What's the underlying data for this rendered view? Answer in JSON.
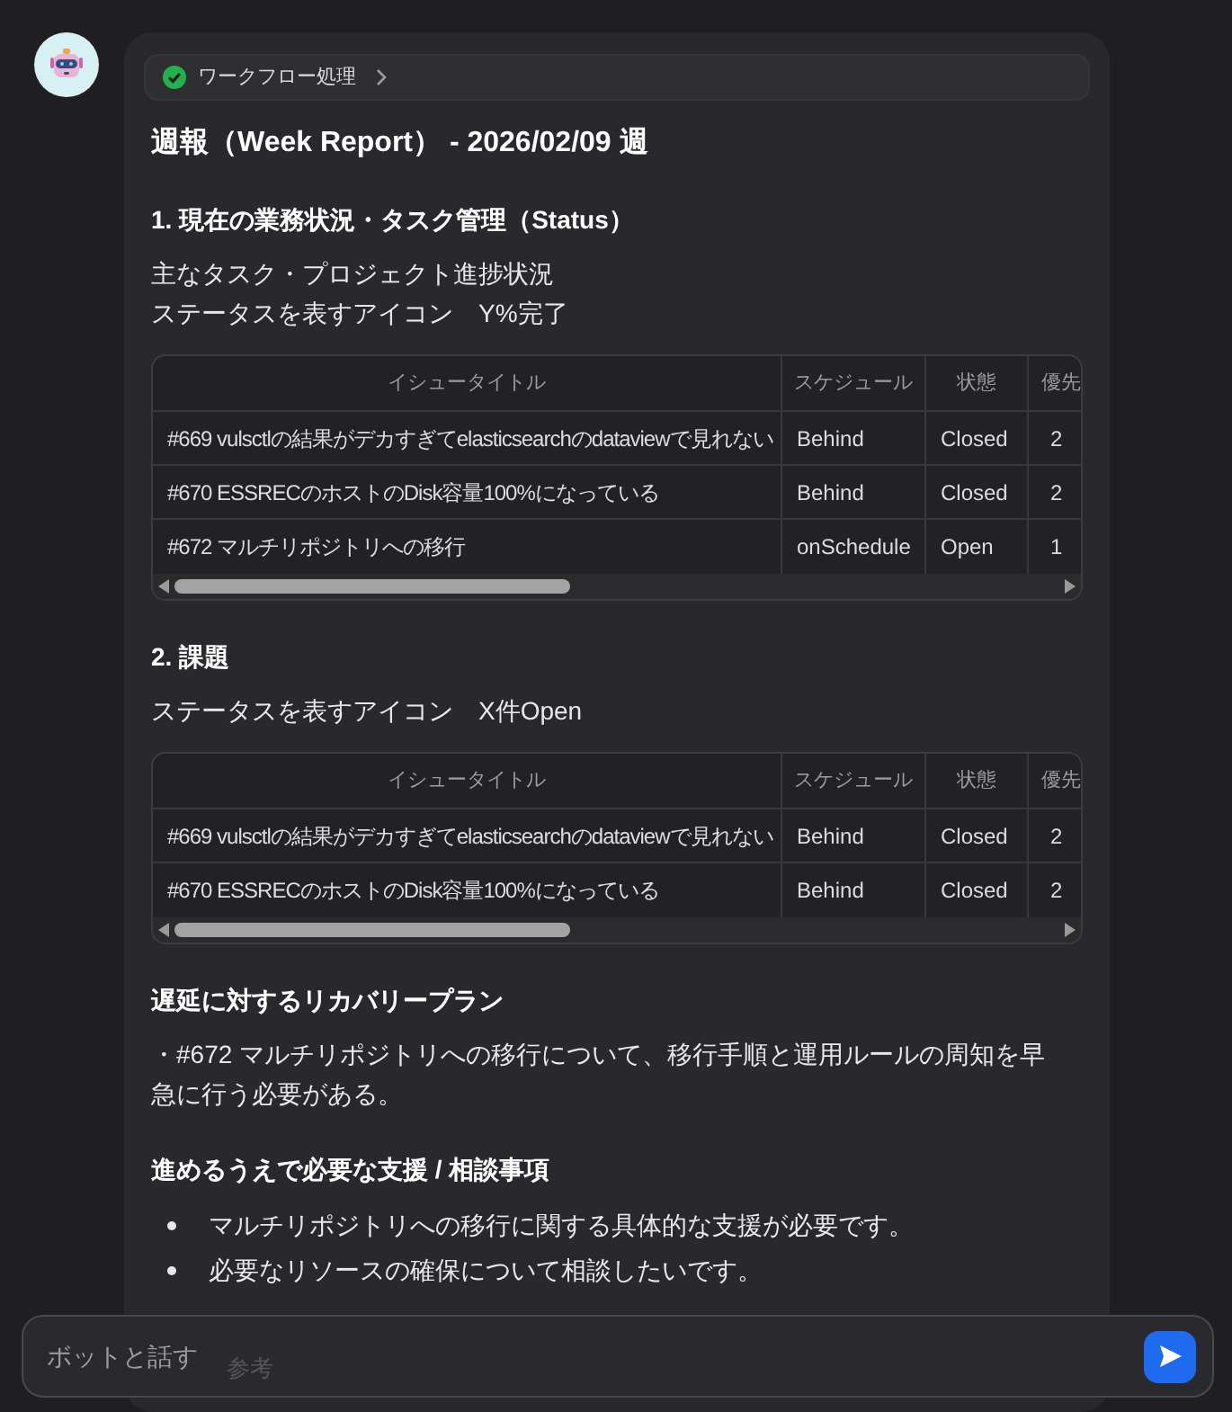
{
  "workflow": {
    "label": "ワークフロー処理"
  },
  "title": "週報（Week Report） - 2026/02/09 週",
  "sections": [
    {
      "heading": "1. 現在の業務状況・タスク管理（Status）",
      "lines": [
        "主なタスク・プロジェクト進捗状況",
        "ステータスを表すアイコン　Y%完了"
      ],
      "table": {
        "columns": [
          "イシュータイトル",
          "スケジュール",
          "状態",
          "優先"
        ],
        "rows": [
          [
            "#669 vulsctlの結果がデカすぎてelasticsearchのdataviewで見れない",
            "Behind",
            "Closed",
            "2"
          ],
          [
            "#670 ESSRECのホストのDisk容量100%になっている",
            "Behind",
            "Closed",
            "2"
          ],
          [
            "#672 マルチリポジトリへの移行",
            "onSchedule",
            "Open",
            "1"
          ]
        ]
      }
    },
    {
      "heading": "2. 課題",
      "lines": [
        "ステータスを表すアイコン　X件Open"
      ],
      "table": {
        "columns": [
          "イシュータイトル",
          "スケジュール",
          "状態",
          "優先"
        ],
        "rows": [
          [
            "#669 vulsctlの結果がデカすぎてelasticsearchのdataviewで見れない",
            "Behind",
            "Closed",
            "2"
          ],
          [
            "#670 ESSRECのホストのDisk容量100%になっている",
            "Behind",
            "Closed",
            "2"
          ]
        ]
      }
    },
    {
      "heading": "遅延に対するリカバリープラン",
      "lines": [
        "・#672 マルチリポジトリへの移行について、移行手順と運用ルールの周知を早急に行う必要がある。"
      ]
    },
    {
      "heading": "進めるうえで必要な支援 / 相談事項",
      "bullets": [
        "マルチリポジトリへの移行に関する具体的な支援が必要です。",
        "必要なリソースの確保について相談したいです。"
      ]
    }
  ],
  "references": {
    "label": "参考"
  },
  "input": {
    "placeholder": "ボットと話す"
  }
}
